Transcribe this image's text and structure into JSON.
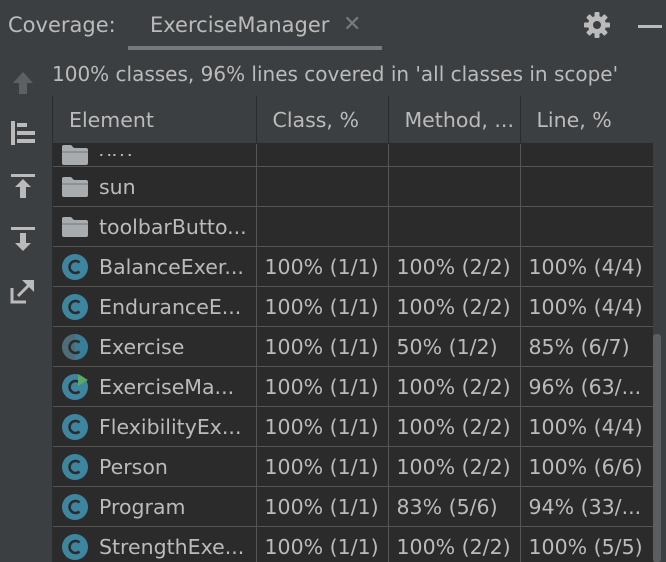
{
  "header": {
    "label": "Coverage:",
    "tab_title": "ExerciseManager",
    "tab_close": "✕"
  },
  "summary": "100% classes, 96% lines covered in 'all classes in scope'",
  "table": {
    "columns": [
      "Element",
      "Class, %",
      "Method, ...",
      "Line, %"
    ],
    "rows": [
      {
        "icon": "folder",
        "name": "org",
        "class": "",
        "method": "",
        "line": ""
      },
      {
        "icon": "folder",
        "name": "sun",
        "class": "",
        "method": "",
        "line": ""
      },
      {
        "icon": "folder",
        "name": "toolbarButto...",
        "class": "",
        "method": "",
        "line": ""
      },
      {
        "icon": "class",
        "name": "BalanceExer...",
        "class": "100% (1/1)",
        "method": "100% (2/2)",
        "line": "100% (4/4)"
      },
      {
        "icon": "class",
        "name": "EnduranceE...",
        "class": "100% (1/1)",
        "method": "100% (2/2)",
        "line": "100% (4/4)"
      },
      {
        "icon": "abstract-class",
        "name": "Exercise",
        "class": "100% (1/1)",
        "method": "50% (1/2)",
        "line": "85% (6/7)"
      },
      {
        "icon": "main-class",
        "name": "ExerciseMa...",
        "class": "100% (1/1)",
        "method": "100% (2/2)",
        "line": "96% (63/..."
      },
      {
        "icon": "class",
        "name": "FlexibilityEx...",
        "class": "100% (1/1)",
        "method": "100% (2/2)",
        "line": "100% (4/4)"
      },
      {
        "icon": "class",
        "name": "Person",
        "class": "100% (1/1)",
        "method": "100% (2/2)",
        "line": "100% (6/6)"
      },
      {
        "icon": "class",
        "name": "Program",
        "class": "100% (1/1)",
        "method": "83% (5/6)",
        "line": "94% (33/..."
      },
      {
        "icon": "class",
        "name": "StrengthExe...",
        "class": "100% (1/1)",
        "method": "100% (2/2)",
        "line": "100% (5/5)"
      }
    ]
  },
  "colors": {
    "background": "#3c3f41",
    "table_bg": "#2b2b2b",
    "text": "#bbbbbb",
    "class_icon": "#3e86a0",
    "run_marker": "#59a869"
  }
}
